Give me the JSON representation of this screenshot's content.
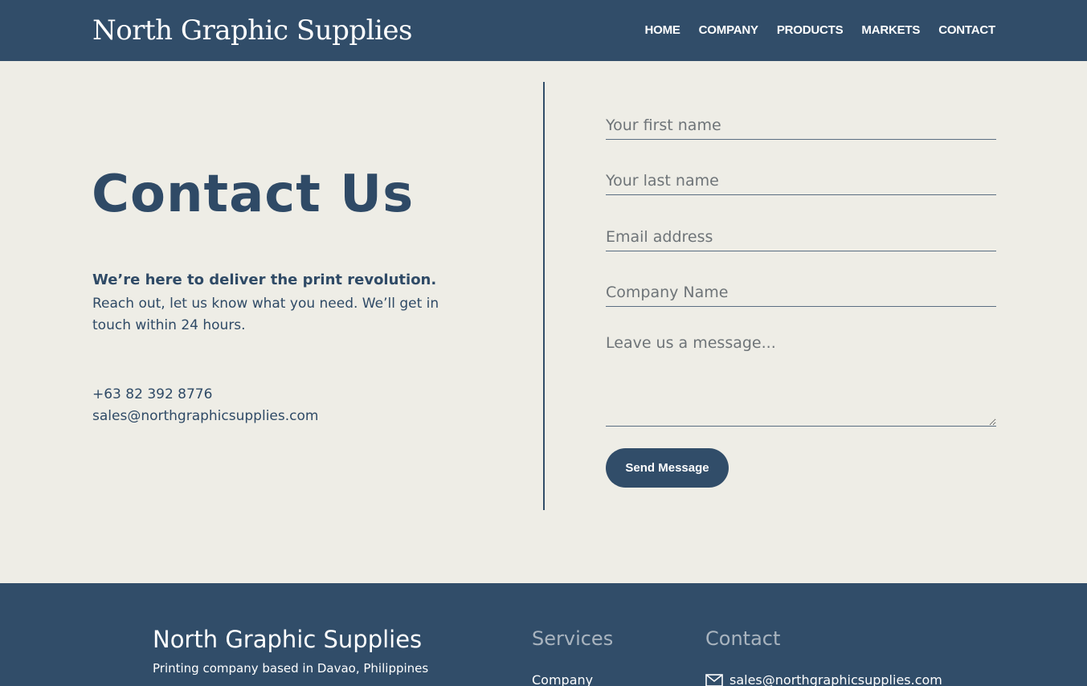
{
  "header": {
    "brand": "North Graphic Supplies",
    "nav": [
      "HOME",
      "COMPANY",
      "PRODUCTS",
      "MARKETS",
      "CONTACT"
    ]
  },
  "contact": {
    "title": "Contact Us",
    "tagline": "We’re here to deliver the print revolution.",
    "intro": "Reach out, let us know what you need. We’ll get in touch within 24 hours.",
    "phone": "+63 82 392 8776",
    "email": "sales@northgraphicsupplies.com"
  },
  "form": {
    "first_name_placeholder": "Your first name",
    "last_name_placeholder": "Your last name",
    "email_placeholder": "Email address",
    "company_placeholder": "Company Name",
    "message_placeholder": "Leave us a message...",
    "submit_label": "Send Message"
  },
  "footer": {
    "brand": "North Graphic Supplies",
    "subtitle": "Printing company based in Davao, Philippines",
    "services_heading": "Services",
    "contact_heading": "Contact",
    "services_links": [
      "Company"
    ],
    "contact_email": "sales@northgraphicsupplies.com",
    "contact_icon": "envelope-icon"
  },
  "colors": {
    "primary": "#314d69",
    "background": "#eeede6",
    "footer_heading": "#a9b4bf"
  }
}
